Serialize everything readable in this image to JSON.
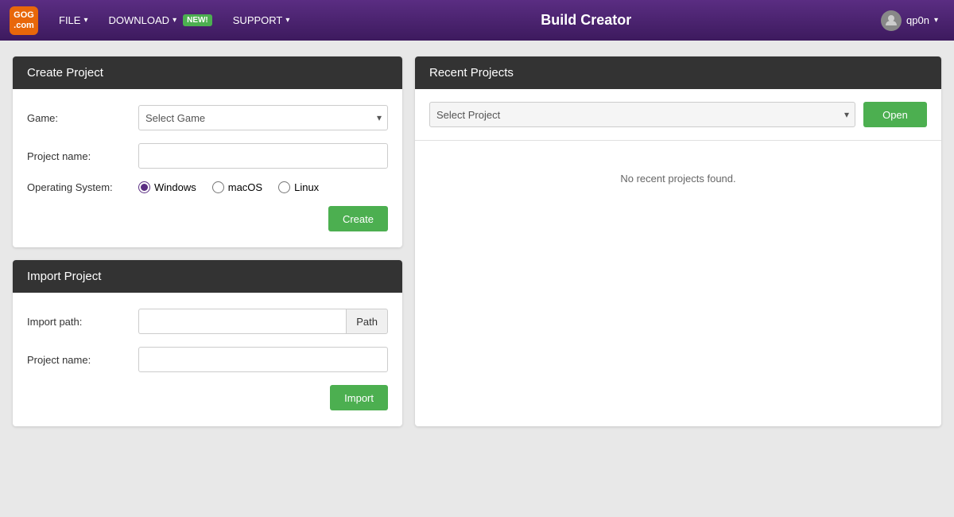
{
  "topnav": {
    "logo_line1": "GOG",
    "logo_line2": ".com",
    "title": "Build Creator",
    "menu": [
      {
        "label": "FILE",
        "has_arrow": true,
        "badge": null
      },
      {
        "label": "DOWNLOAD",
        "has_arrow": true,
        "badge": "NEW!"
      },
      {
        "label": "SUPPORT",
        "has_arrow": true,
        "badge": null
      }
    ],
    "user": {
      "name": "qp0n",
      "avatar_icon": "user-avatar-icon"
    }
  },
  "create_project": {
    "header": "Create Project",
    "game_label": "Game:",
    "game_placeholder": "Select Game",
    "project_name_label": "Project name:",
    "project_name_value": "",
    "os_label": "Operating System:",
    "os_options": [
      {
        "value": "windows",
        "label": "Windows",
        "checked": true
      },
      {
        "value": "macos",
        "label": "macOS",
        "checked": false
      },
      {
        "value": "linux",
        "label": "Linux",
        "checked": false
      }
    ],
    "create_button": "Create"
  },
  "import_project": {
    "header": "Import Project",
    "import_path_label": "Import path:",
    "import_path_value": "",
    "path_button": "Path",
    "project_name_label": "Project name:",
    "project_name_value": "",
    "import_button": "Import"
  },
  "recent_projects": {
    "header": "Recent Projects",
    "select_placeholder": "Select Project",
    "open_button": "Open",
    "empty_message": "No recent projects found."
  }
}
